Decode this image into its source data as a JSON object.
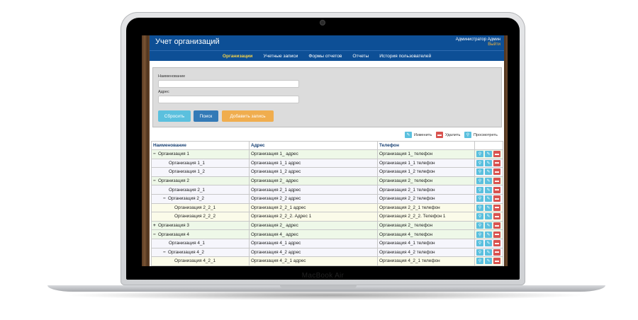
{
  "device": {
    "brand": "MacBook Air"
  },
  "app": {
    "title": "Учет организаций",
    "user": "Администратор Админ",
    "logout": "Выйти"
  },
  "nav": [
    {
      "label": "Организации",
      "active": true
    },
    {
      "label": "Учетные записи",
      "active": false
    },
    {
      "label": "Формы отчетов",
      "active": false
    },
    {
      "label": "Отчеты",
      "active": false
    },
    {
      "label": "История пользователей",
      "active": false
    }
  ],
  "filter": {
    "name_label": "Наименование",
    "address_label": "Адрес",
    "name_value": "",
    "address_value": "",
    "reset_label": "Сбросить",
    "search_label": "Поиск",
    "add_label": "Добавить запись"
  },
  "legend": {
    "edit": "Изменить",
    "delete": "Удалить",
    "view": "Просмотреть"
  },
  "table": {
    "headers": [
      "Наименование",
      "Адрес",
      "Телефон"
    ],
    "rows": [
      {
        "name": "Организация 1",
        "address": "Организация 1_ адрес",
        "phone": "Организация 1_ телефон",
        "level": 0,
        "toggle": "−",
        "tone": "g"
      },
      {
        "name": "Организация 1_1",
        "address": "Организация 1_1 адрес",
        "phone": "Организация 1_1 телефон",
        "level": 1,
        "toggle": "",
        "tone": "w"
      },
      {
        "name": "Организация 1_2",
        "address": "Организация 1_2 адрес",
        "phone": "Организация 1_2 телефон",
        "level": 1,
        "toggle": "",
        "tone": "w"
      },
      {
        "name": "Организация 2",
        "address": "Организация 2_ адрес",
        "phone": "Организация 2_ телефон",
        "level": 0,
        "toggle": "−",
        "tone": "g"
      },
      {
        "name": "Организация 2_1",
        "address": "Организация 2_1 адрес",
        "phone": "Организация 2_1 телефон",
        "level": 1,
        "toggle": "",
        "tone": "w"
      },
      {
        "name": "Организация 2_2",
        "address": "Организация 2_2 адрес",
        "phone": "Организация 2_2 телефон",
        "level": 1,
        "toggle": "−",
        "tone": "w"
      },
      {
        "name": "Организация 2_2_1",
        "address": "Организация 2_2_1 адрес",
        "phone": "Организация 2_2_1 телефон",
        "level": 2,
        "toggle": "",
        "tone": "y"
      },
      {
        "name": "Организация 2_2_2",
        "address": "Организация 2_2_2. Адрес 1",
        "phone": "Организация 2_2_2. Телефон 1",
        "level": 2,
        "toggle": "",
        "tone": "y"
      },
      {
        "name": "Организация 3",
        "address": "Организация 2_ адрес",
        "phone": "Организация 2_ телефон",
        "level": 0,
        "toggle": "+",
        "tone": "g"
      },
      {
        "name": "Организация 4",
        "address": "Организация 4_ адрес",
        "phone": "Организация 4_ телефон",
        "level": 0,
        "toggle": "−",
        "tone": "g"
      },
      {
        "name": "Организация 4_1",
        "address": "Организация 4_1 адрес",
        "phone": "Организация 4_1 телефон",
        "level": 1,
        "toggle": "",
        "tone": "w"
      },
      {
        "name": "Организация 4_2",
        "address": "Организация 4_2 адрес",
        "phone": "Организация 4_2 телефон",
        "level": 1,
        "toggle": "−",
        "tone": "w"
      },
      {
        "name": "Организация 4_2_1",
        "address": "Организация 4_2_1 адрес",
        "phone": "Организация 4_2_1 телефон",
        "level": 2,
        "toggle": "",
        "tone": "y"
      }
    ]
  },
  "icons": {
    "view": "magnifier-icon",
    "edit": "pencil-icon",
    "delete": "trash-icon"
  },
  "colors": {
    "header": "#0d4f96",
    "active_nav": "#f3d24a",
    "reset": "#5bc0de",
    "search": "#337ab7",
    "add": "#f0ad4e",
    "delete": "#d9534f"
  }
}
